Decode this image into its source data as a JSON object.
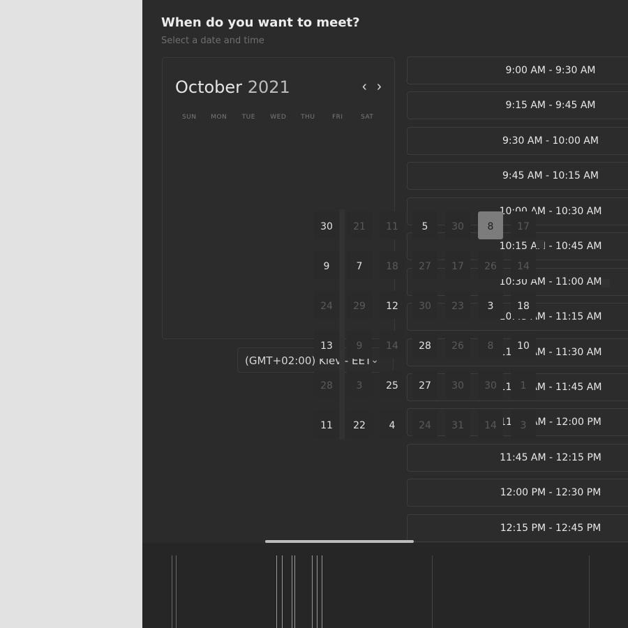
{
  "header": {
    "title": "When do you want to meet?",
    "subtitle": "Select a date and time"
  },
  "calendar": {
    "month": "October",
    "year": "2021",
    "prev_icon": "chevron-left-icon",
    "next_icon": "chevron-right-icon",
    "weekdays": [
      "SUN",
      "MON",
      "TUE",
      "WED",
      "THU",
      "FRI",
      "SAT"
    ],
    "days": [
      {
        "label": "30",
        "style": "bright"
      },
      {
        "label": "21",
        "style": "dim"
      },
      {
        "label": "11",
        "style": "dim"
      },
      {
        "label": "5",
        "style": "bright"
      },
      {
        "label": "30",
        "style": "dim"
      },
      {
        "label": "8",
        "style": "sel"
      },
      {
        "label": "17",
        "style": "dim"
      },
      {
        "label": "9",
        "style": "bright"
      },
      {
        "label": "7",
        "style": "bright"
      },
      {
        "label": "18",
        "style": "dim"
      },
      {
        "label": "27",
        "style": "dim"
      },
      {
        "label": "17",
        "style": "dim"
      },
      {
        "label": "26",
        "style": "dim"
      },
      {
        "label": "14",
        "style": "dim"
      },
      {
        "label": "24",
        "style": "dim"
      },
      {
        "label": "29",
        "style": "dim"
      },
      {
        "label": "12",
        "style": "bright"
      },
      {
        "label": "30",
        "style": "dim"
      },
      {
        "label": "23",
        "style": "dim"
      },
      {
        "label": "3",
        "style": "bright"
      },
      {
        "label": "18",
        "style": "bright"
      },
      {
        "label": "13",
        "style": "bright"
      },
      {
        "label": "9",
        "style": "dim"
      },
      {
        "label": "14",
        "style": "dim"
      },
      {
        "label": "28",
        "style": "bright"
      },
      {
        "label": "26",
        "style": "dim"
      },
      {
        "label": "8",
        "style": "dim"
      },
      {
        "label": "10",
        "style": "bright"
      },
      {
        "label": "28",
        "style": "dim"
      },
      {
        "label": "3",
        "style": "dim"
      },
      {
        "label": "25",
        "style": "bright"
      },
      {
        "label": "27",
        "style": "bright"
      },
      {
        "label": "30",
        "style": "dim"
      },
      {
        "label": "30",
        "style": "dim"
      },
      {
        "label": "1",
        "style": "dim"
      },
      {
        "label": "11",
        "style": "bright"
      },
      {
        "label": "22",
        "style": "bright"
      },
      {
        "label": "4",
        "style": "bright"
      },
      {
        "label": "24",
        "style": "dim"
      },
      {
        "label": "31",
        "style": "dim"
      },
      {
        "label": "14",
        "style": "dim"
      },
      {
        "label": "3",
        "style": "dim"
      }
    ]
  },
  "timezone": {
    "label": "(GMT+02:00) Kiev - EET",
    "icon": "chevron-down-icon"
  },
  "slots": [
    "9:00 AM - 9:30 AM",
    "9:15 AM - 9:45 AM",
    "9:30 AM - 10:00 AM",
    "9:45 AM - 10:15 AM",
    "10:00 AM - 10:30 AM",
    "10:15 AM - 10:45 AM",
    "10:30 AM - 11:00 AM",
    "10:45 AM - 11:15 AM",
    "11:00 AM - 11:30 AM",
    "11:15 AM - 11:45 AM",
    "11:30 AM - 12:00 PM",
    "11:45 AM - 12:15 PM",
    "12:00 PM - 12:30 PM",
    "12:15 PM - 12:45 PM"
  ],
  "colors": {
    "background": "#2b2b2b",
    "page": "#e2e2e2",
    "selected_day": "#7c7c7c"
  }
}
